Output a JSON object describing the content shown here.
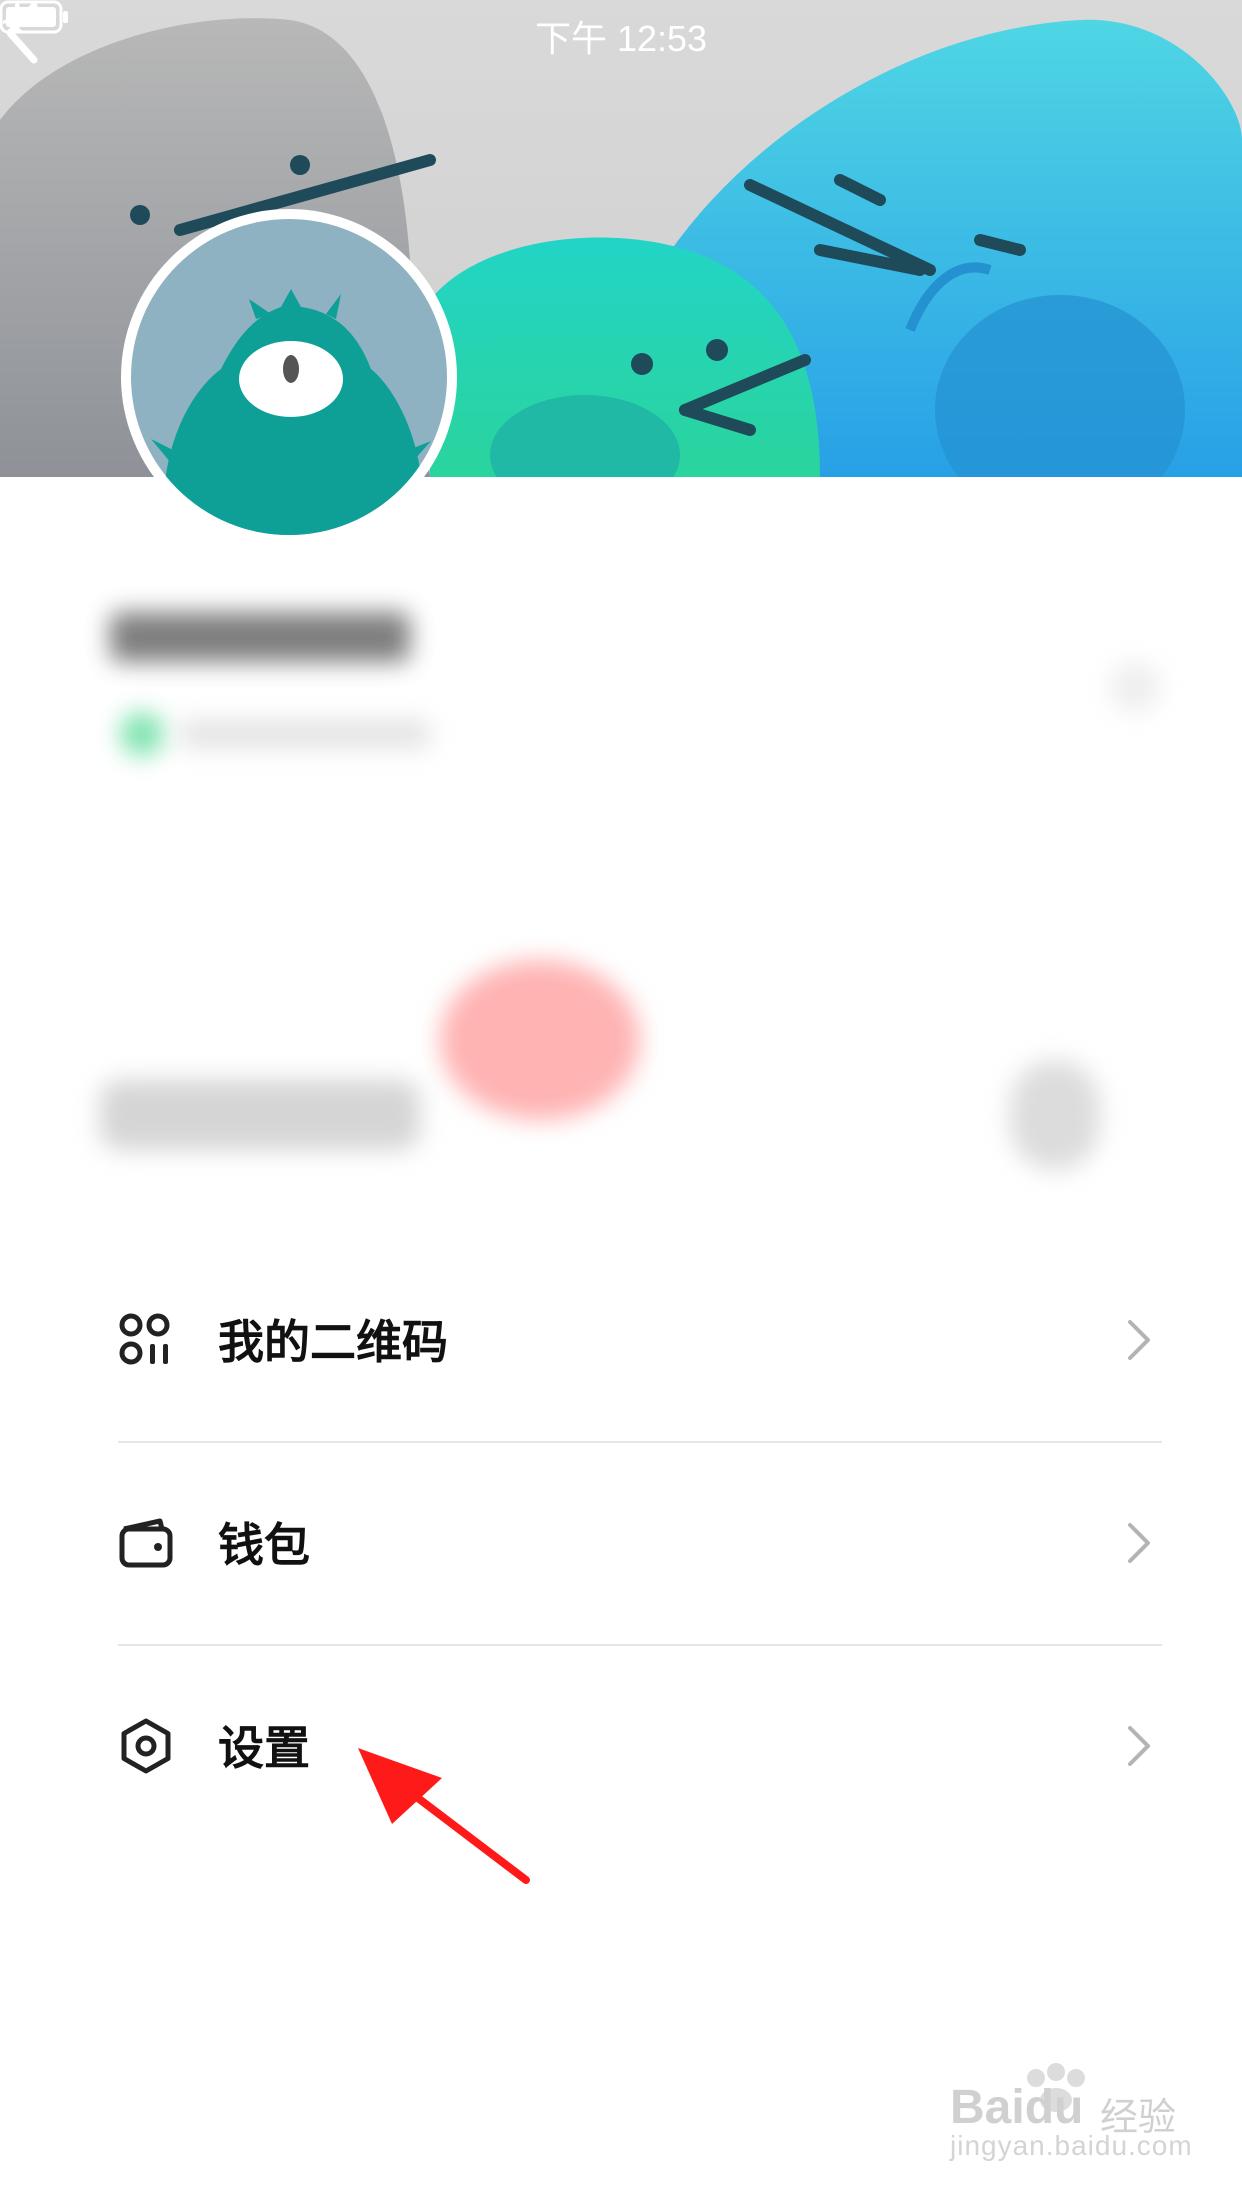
{
  "status_bar": {
    "time": "下午 12:53",
    "icons": [
      "airplane-icon",
      "battery-icon"
    ]
  },
  "header": {
    "back_icon": "chevron-left-icon",
    "banner_colors": [
      "#8a8f95",
      "#2ad0b4",
      "#2aa6e8"
    ]
  },
  "menu": {
    "items": [
      {
        "label": "我的二维码",
        "icon": "qr-code-icon"
      },
      {
        "label": "钱包",
        "icon": "wallet-icon"
      },
      {
        "label": "设置",
        "icon": "settings-hex-icon"
      }
    ],
    "chevron_icon": "chevron-right-icon"
  },
  "annotation": {
    "arrow_color": "#ff1a1a"
  },
  "watermark": {
    "brand": "Baidu",
    "cn": "经验",
    "url": "jingyan.baidu.com"
  }
}
